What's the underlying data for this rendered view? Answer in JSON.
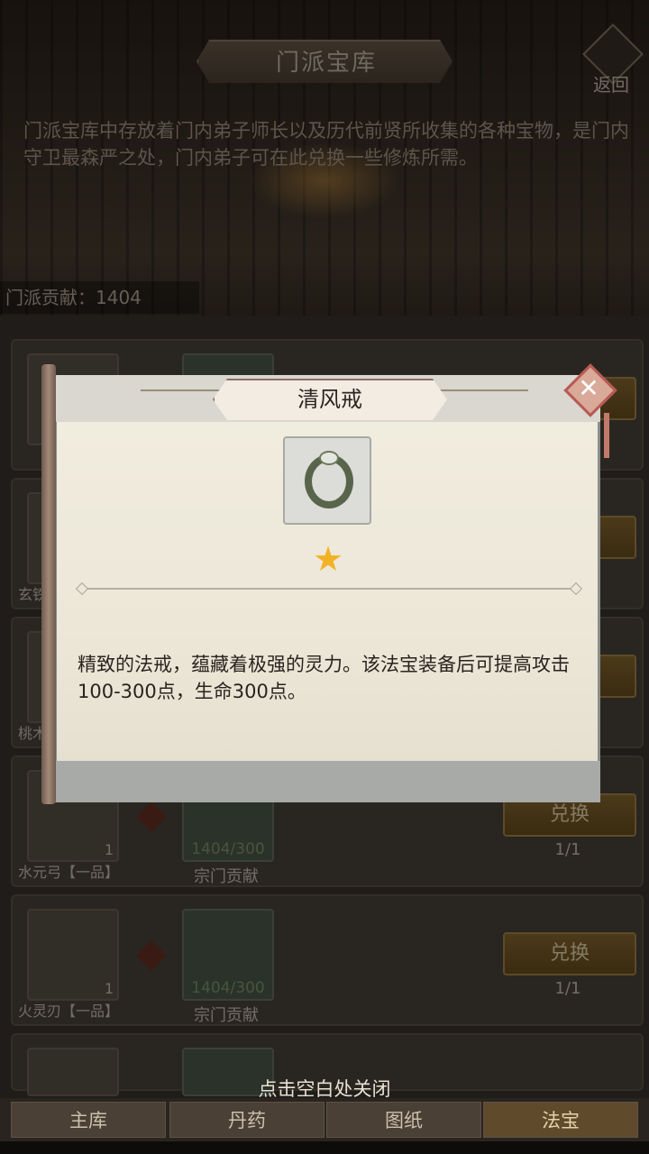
{
  "header": {
    "title": "门派宝库",
    "back_label": "返回",
    "description": "门派宝库中存放着门内弟子师长以及历代前贤所收集的各种宝物，是门内守卫最森严之处，门内弟子可在此兑换一些修炼所需。",
    "contribution_label": "门派贡献：1404"
  },
  "list": {
    "rows": [
      {
        "name": "",
        "count": "",
        "cost_amount": "",
        "cost_name": "",
        "exchange": "",
        "limit": ""
      },
      {
        "name": "玄铁",
        "count": "",
        "cost_amount": "",
        "cost_name": "",
        "exchange": "",
        "limit": ""
      },
      {
        "name": "桃木",
        "count": "",
        "cost_amount": "",
        "cost_name": "",
        "exchange": "",
        "limit": ""
      },
      {
        "name": "水元弓【一品】",
        "count": "1",
        "cost_amount": "1404/300",
        "cost_name": "宗门贡献",
        "exchange": "兑换",
        "limit": "1/1"
      },
      {
        "name": "火灵刃【一品】",
        "count": "1",
        "cost_amount": "1404/300",
        "cost_name": "宗门贡献",
        "exchange": "兑换",
        "limit": "1/1"
      }
    ]
  },
  "modal": {
    "title": "清风戒",
    "item_icon": "jade-ring-icon",
    "stars": "★",
    "description": "精致的法戒，蕴藏着极强的灵力。该法宝装备后可提高攻击100-300点，生命300点。",
    "close_icon": "close-icon"
  },
  "hint": "点击空白处关闭",
  "tabs": [
    {
      "label": "主库",
      "active": false
    },
    {
      "label": "丹药",
      "active": false
    },
    {
      "label": "图纸",
      "active": false
    },
    {
      "label": "法宝",
      "active": true
    }
  ],
  "colors": {
    "accent_gold": "#f2b227",
    "close_red": "#b85a54",
    "cost_green": "#7f9c72"
  }
}
